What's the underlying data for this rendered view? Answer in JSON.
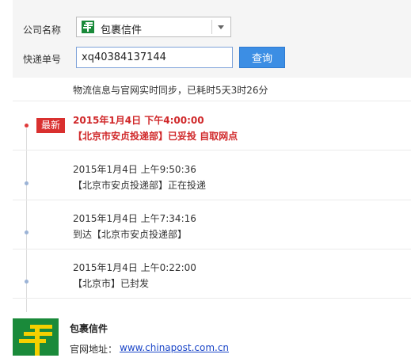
{
  "form": {
    "company_label": "公司名称",
    "company_value": "包裹信件",
    "tracking_label": "快递单号",
    "tracking_value": "xq40384137144",
    "query_button": "查询"
  },
  "sync_info": "物流信息与官网实时同步，已耗时5天3时26分",
  "latest_badge": "最新",
  "events": [
    {
      "time": "2015年1月4日  下午4:00:00",
      "desc": "【北京市安贞投递部】已妥投 自取网点"
    },
    {
      "time": "2015年1月4日  上午9:50:36",
      "desc": "【北京市安贞投递部】正在投递"
    },
    {
      "time": "2015年1月4日  上午7:34:16",
      "desc": "到达【北京市安贞投递部】"
    },
    {
      "time": "2015年1月4日  上午0:22:00",
      "desc": "【北京市】已封发"
    }
  ],
  "footer": {
    "carrier_name": "包裹信件",
    "website_label": "官网地址：",
    "website_url": "www.chinapost.com.cn"
  },
  "colors": {
    "brand_green": "#1a8a3a",
    "accent_red": "#d0282a",
    "button_blue": "#3c8ee4"
  }
}
